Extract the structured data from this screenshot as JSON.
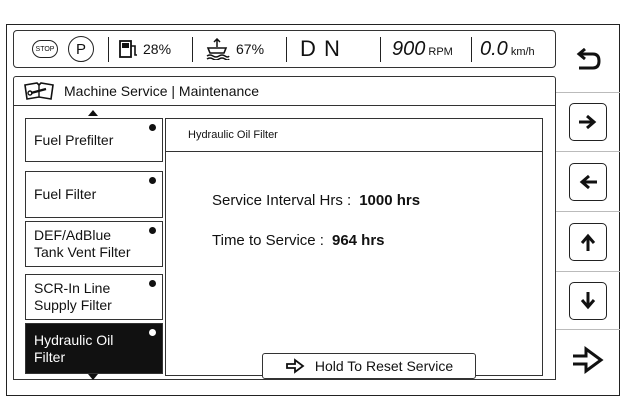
{
  "status_bar": {
    "stop_label": "STOP",
    "park_label": "P",
    "fuel_pct": "28%",
    "def_pct": "67%",
    "gear": "D N",
    "rpm_value": "900",
    "rpm_unit": "RPM",
    "speed_value": "0.0",
    "speed_unit": "km/h"
  },
  "header": {
    "title": "Machine Service | Maintenance"
  },
  "service_list": [
    {
      "label": "Fuel Prefilter"
    },
    {
      "label": "Fuel Filter"
    },
    {
      "label": "DEF/AdBlue Tank Vent Filter"
    },
    {
      "label": "SCR-In Line Supply Filter"
    },
    {
      "label": "Hydraulic Oil Filter",
      "selected": true
    }
  ],
  "detail": {
    "title": "Hydraulic Oil Filter",
    "interval_label": "Service Interval Hrs :",
    "interval_value": "1000 hrs",
    "time_label": "Time to Service :",
    "time_value": "964 hrs",
    "reset_label": "Hold To Reset Service"
  },
  "side_buttons": [
    {
      "icon": "back-icon"
    },
    {
      "icon": "arrow-right-icon"
    },
    {
      "icon": "arrow-left-icon"
    },
    {
      "icon": "arrow-up-icon"
    },
    {
      "icon": "arrow-down-icon"
    },
    {
      "icon": "enter-icon"
    }
  ]
}
